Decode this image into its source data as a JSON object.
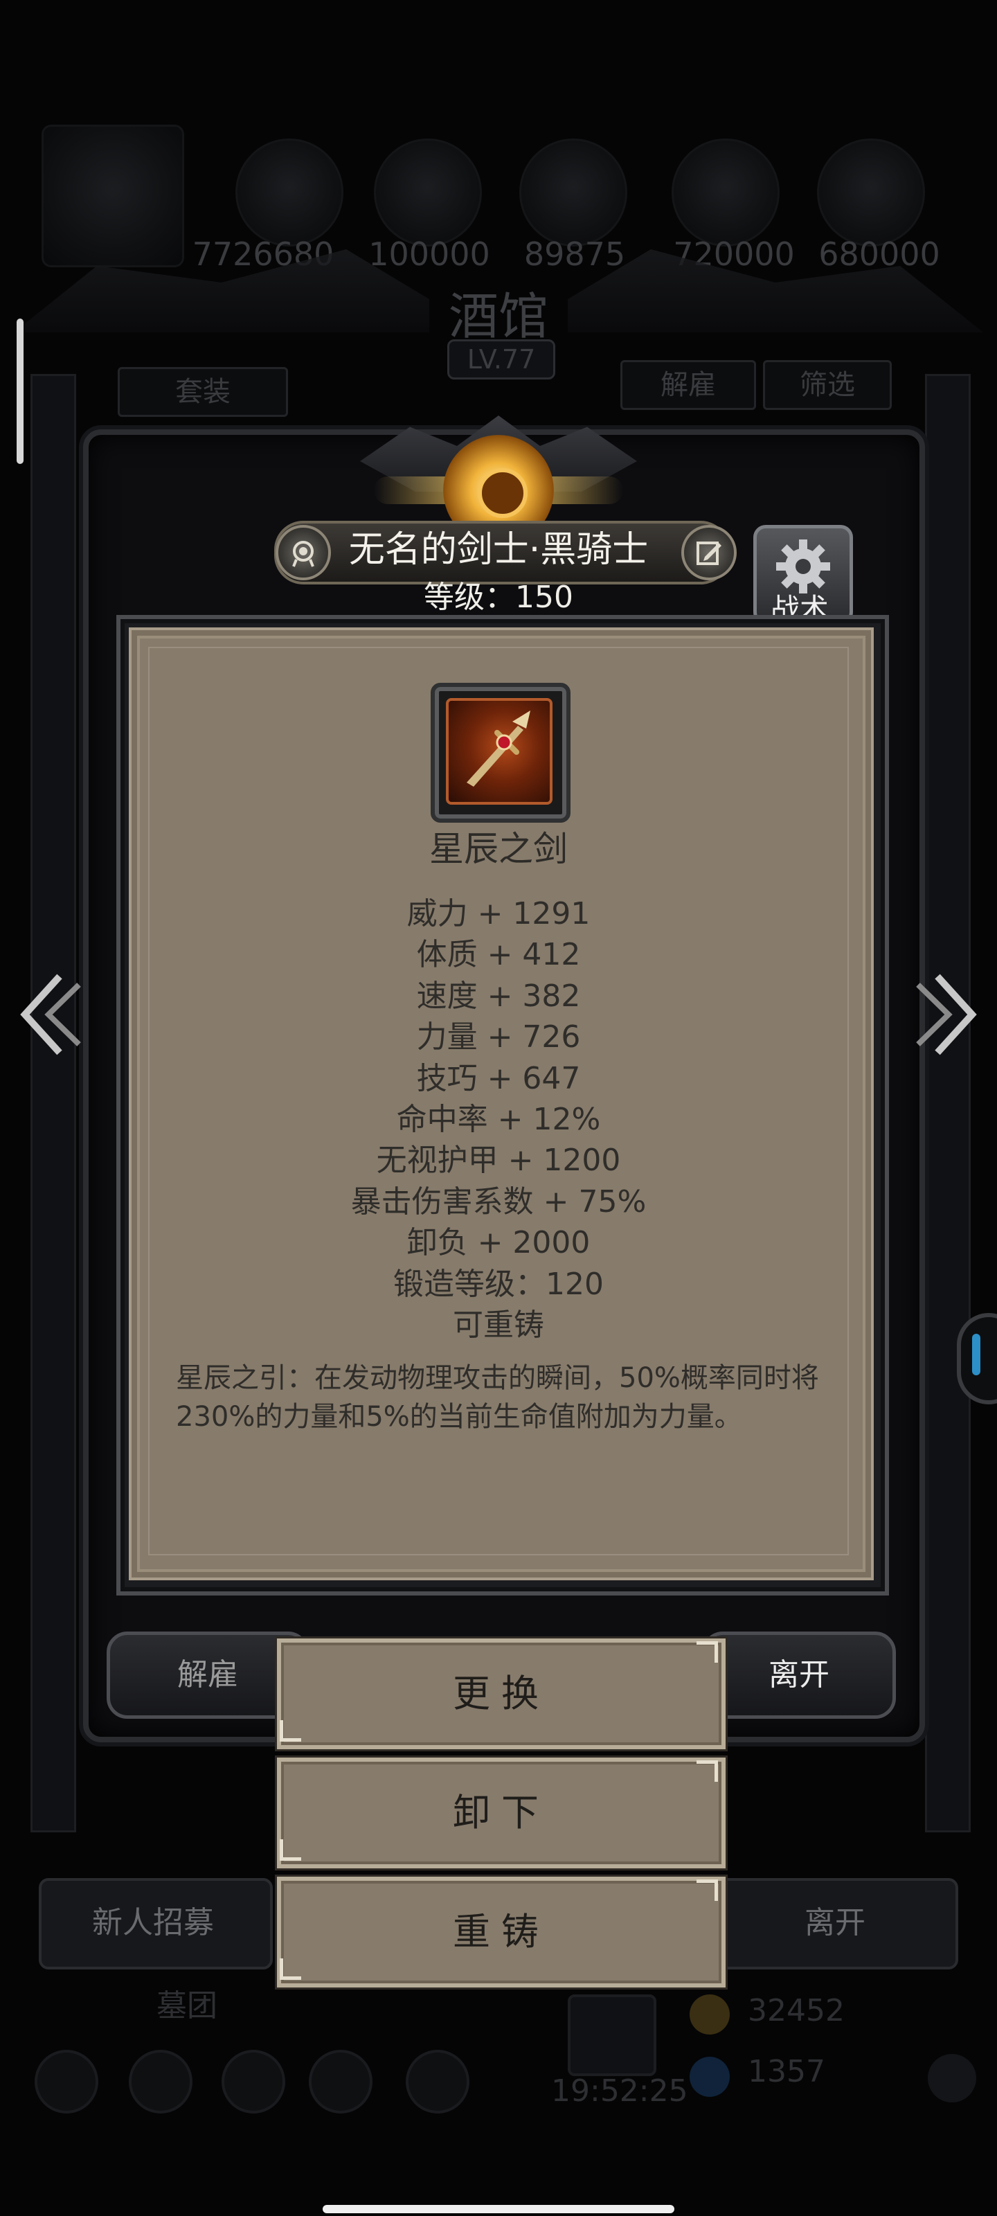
{
  "background": {
    "resources": [
      "7726680",
      "100000",
      "89875",
      "720000",
      "680000"
    ],
    "tavern_title": "酒馆",
    "tavern_level": "LV.77",
    "set_label": "套装",
    "dismiss_label": "解雇",
    "filter_label": "筛选",
    "recruit_label": "新人招募",
    "leave_label": "离开",
    "guild_label": "墓团",
    "timer": "19:52:25",
    "gold": "32452",
    "gems": "1357"
  },
  "hero": {
    "name": "无名的剑士·黑骑士",
    "level_text": "等级：150",
    "tactics_label": "战术"
  },
  "item": {
    "name": "星辰之剑",
    "stats": [
      "威力 + 1291",
      "体质 + 412",
      "速度 + 382",
      "力量 + 726",
      "技巧 + 647",
      "命中率 + 12%",
      "无视护甲 + 1200",
      "暴击伤害系数 + 75%",
      "卸负 + 2000",
      "锻造等级：120",
      "可重铸"
    ],
    "description": "星辰之引：在发动物理攻击的瞬间，50%概率同时将230%的力量和5%的当前生命值附加为力量。"
  },
  "actions": {
    "dismiss": "解雇",
    "leave": "离开",
    "replace": "更换",
    "unequip": "卸下",
    "reforge": "重铸"
  }
}
